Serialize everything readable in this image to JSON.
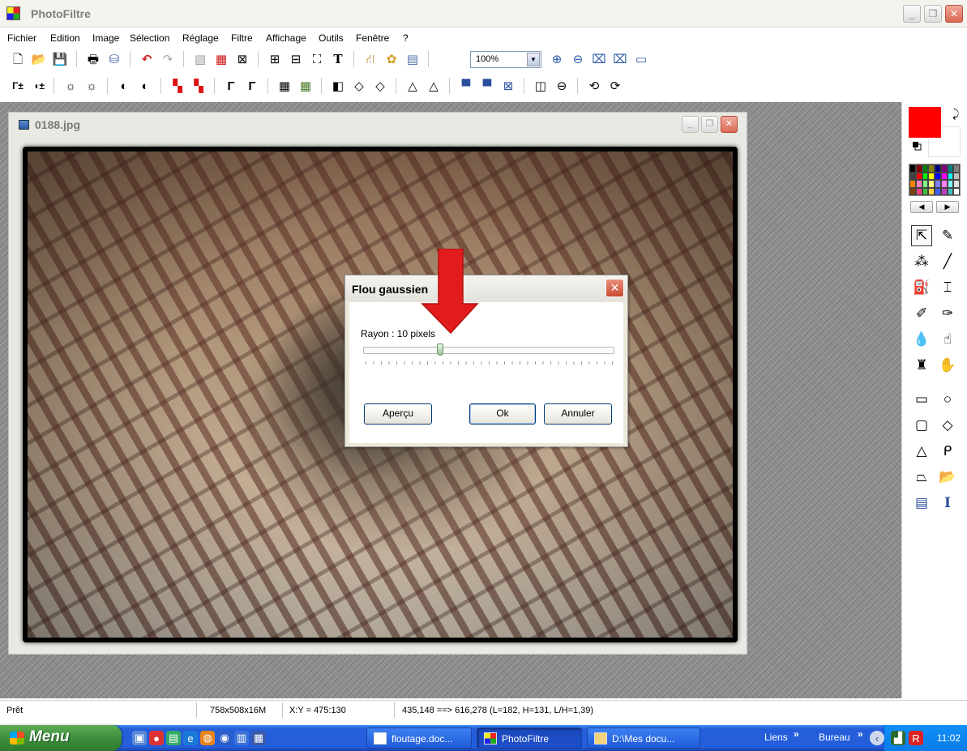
{
  "app": {
    "title": "PhotoFiltre",
    "window_controls": [
      "_",
      "❐",
      "✕"
    ]
  },
  "menu": [
    "Fichier",
    "Edition",
    "Image",
    "Sélection",
    "Réglage",
    "Filtre",
    "Affichage",
    "Outils",
    "Fenêtre",
    "?"
  ],
  "toolbar": {
    "zoom_value": "100%"
  },
  "document": {
    "title": "0188.jpg"
  },
  "dialog": {
    "title": "Flou gaussien",
    "close": "✕",
    "radius_label": "Rayon : 10 pixels",
    "radius_value": 10,
    "buttons": {
      "preview": "Aperçu",
      "ok": "Ok",
      "cancel": "Annuler"
    }
  },
  "palette": {
    "foreground_color": "#ff0000",
    "background_color": "#ffffff"
  },
  "status": {
    "state": "Prêt",
    "image_size": "758x508x16M",
    "cursor": "X:Y = 475:130",
    "selection": "435,148 ==> 616,278 (L=182, H=131, L/H=1,39)"
  },
  "taskbar": {
    "start_label": "Menu",
    "tasks": [
      "floutage.doc...",
      "PhotoFiltre",
      "D:\\Mes docu..."
    ],
    "links_label": "Liens",
    "desktop_label": "Bureau",
    "chevron": "»",
    "clock": "11:02"
  }
}
